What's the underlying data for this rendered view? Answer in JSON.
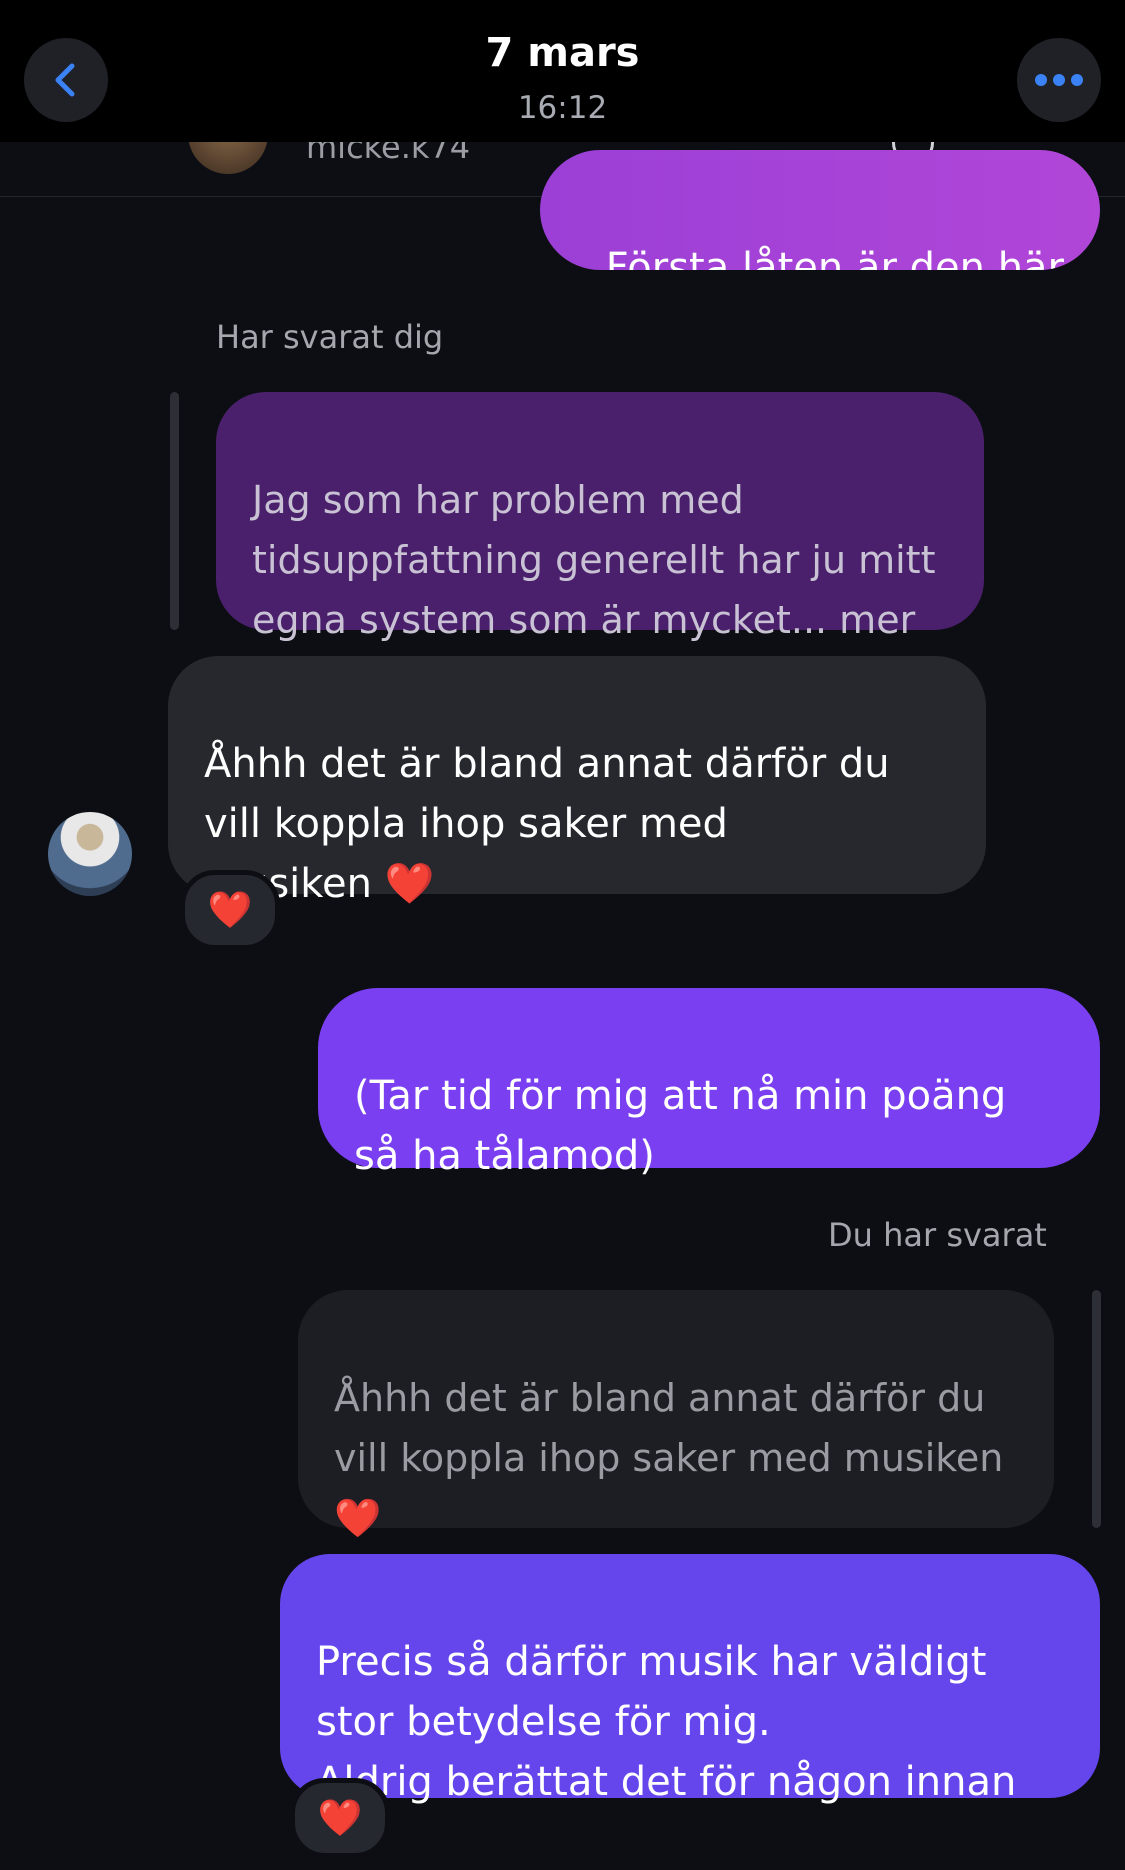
{
  "header": {
    "title": "7 mars",
    "subtitle": "16:12",
    "back_icon": "chevron-left-icon",
    "more_icon": "ellipsis-icon",
    "accent": "#3b82f6"
  },
  "peek": {
    "name": "micke.k74"
  },
  "messages": {
    "m1": "Första låten är den här",
    "label_reply_in": "Har svarat dig",
    "m2_quote": "Jag som har problem med\ntidsuppfattning generellt har ju mitt\negna system som är mycket... mer",
    "m3": "Åhhh det är bland annat därför du\nvill koppla ihop saker med\nmusiken ❤️",
    "m3_reaction": "❤️",
    "m4": "(Tar tid för mig att nå min poäng\nså ha tålamod)",
    "label_reply_out": "Du har svarat",
    "m5_quote": "Åhhh det är bland annat därför du\nvill koppla ihop saker med musiken\n❤️",
    "m6": "Precis så därför musik har väldigt\nstor betydelse för mig.\nAldrig berättat det för någon innan",
    "m6_reaction": "❤️"
  },
  "colors": {
    "sent_bubble": "#7c3aed",
    "received_bubble": "#26282e",
    "quote_purple": "#4a1f6b",
    "quote_gray": "#1c1e23"
  }
}
